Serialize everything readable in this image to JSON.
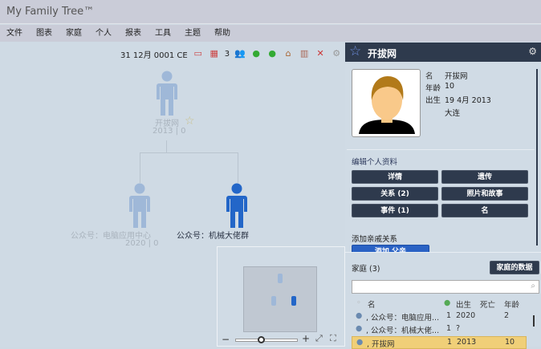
{
  "app": {
    "title": "My Family Tree™"
  },
  "menu": [
    "文件",
    "图表",
    "家庭",
    "个人",
    "报表",
    "工具",
    "主题",
    "帮助"
  ],
  "toolbar": {
    "date": "31 12月 0001 CE",
    "count": "3",
    "icons": [
      "calendar-outline-icon",
      "calendar-icon",
      "people-icon",
      "person-add-left-icon",
      "person-add-right-icon",
      "house-icon",
      "chart-icon",
      "tools-icon",
      "gear-icon"
    ]
  },
  "tree": {
    "root": {
      "name": "开拔网",
      "info": "2013 | 0"
    },
    "children": [
      {
        "name": "公众号：电脑应用中心",
        "info": "2020 | 0"
      },
      {
        "name": "公众号：机械大佬群",
        "info": ""
      }
    ],
    "colors": {
      "faded": "#9fb8d8",
      "selected": "#2366c8"
    }
  },
  "panel": {
    "title": "开拔网",
    "fields": [
      {
        "k": "名",
        "v": "开拔网"
      },
      {
        "k": "年龄",
        "v": "10"
      },
      {
        "k": "出生",
        "v": "19 4月 2013"
      },
      {
        "k": "",
        "v": "大连"
      }
    ],
    "edit_label": "编辑个人资料",
    "buttons": [
      "详情",
      "遗传",
      "关系 (2)",
      "照片和故事",
      "事件 (1)",
      "名"
    ],
    "add_label": "添加亲戚关系",
    "add_button": "添加 父亲"
  },
  "family": {
    "title": "家庭 (3)",
    "data_button": "家庭的数据",
    "search_placeholder": "",
    "columns": [
      "名",
      "出生",
      "死亡",
      "年龄"
    ],
    "rows": [
      {
        "name": ", 公众号：电脑应用...",
        "n": "1",
        "birth": "2020",
        "death": "",
        "age": "2"
      },
      {
        "name": ", 公众号：机械大佬...",
        "n": "1",
        "birth": "?",
        "death": "",
        "age": ""
      },
      {
        "name": ", 开拔网",
        "n": "1",
        "birth": "2013",
        "death": "",
        "age": "10"
      }
    ]
  },
  "minimap": {
    "zoom_minus": "−",
    "zoom_plus": "+"
  }
}
